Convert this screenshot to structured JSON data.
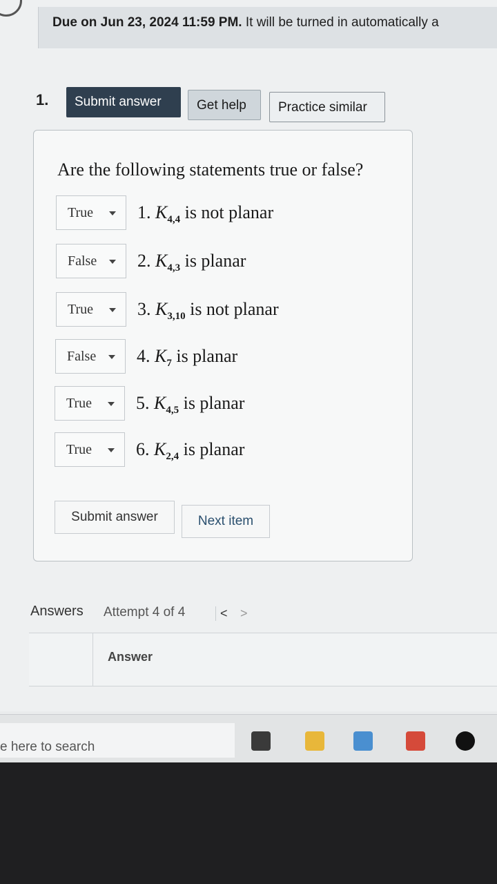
{
  "header": {
    "due_bold": "Due on Jun 23, 2024 11:59 PM.",
    "due_rest": " It will be turned in automatically a"
  },
  "question": {
    "number": "1.",
    "submit_top_label": "Submit answer",
    "get_help_label": "Get help",
    "practice_label": "Practice similar",
    "prompt": "Are the following statements true or false?",
    "items": [
      {
        "value": "True",
        "num": "1.",
        "base": "K",
        "sub": "4,4",
        "rest": " is not planar"
      },
      {
        "value": "False",
        "num": "2.",
        "base": "K",
        "sub": "4,3",
        "rest": " is planar"
      },
      {
        "value": "True",
        "num": "3.",
        "base": "K",
        "sub": "3,10",
        "rest": " is not planar"
      },
      {
        "value": "False",
        "num": "4.",
        "base": "K",
        "sub": "7",
        "rest": " is planar"
      },
      {
        "value": "True",
        "num": "5.",
        "base": "K",
        "sub": "4,5",
        "rest": " is planar"
      },
      {
        "value": "True",
        "num": "6.",
        "base": "K",
        "sub": "2,4",
        "rest": " is planar"
      }
    ],
    "submit_bottom_label": "Submit answer",
    "next_item_label": "Next item"
  },
  "answers": {
    "label": "Answers",
    "attempt": "Attempt 4 of 4",
    "prev": "<",
    "next": ">",
    "column_header": "Answer"
  },
  "taskbar": {
    "search_placeholder": "e here to search",
    "icons": [
      "task-view-icon",
      "file-explorer-icon",
      "store-icon",
      "camera-app-icon",
      "tiktok-icon"
    ],
    "icon_colors": [
      "#3a3a3a",
      "#e8b73a",
      "#4a8fd0",
      "#d54a3a",
      "#111111"
    ]
  }
}
